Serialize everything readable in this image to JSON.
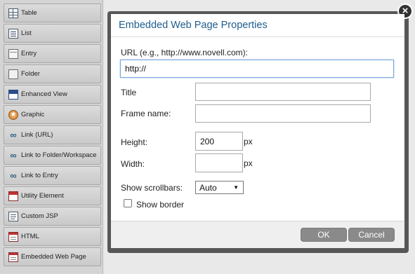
{
  "palette": {
    "items": [
      {
        "label": "Table",
        "icon": "table-icon"
      },
      {
        "label": "List",
        "icon": "list-icon"
      },
      {
        "label": "Entry",
        "icon": "entry-icon"
      },
      {
        "label": "Folder",
        "icon": "folder-icon"
      },
      {
        "label": "Enhanced View",
        "icon": "enhanced-view-icon"
      },
      {
        "label": "Graphic",
        "icon": "graphic-icon"
      },
      {
        "label": "Link (URL)",
        "icon": "link-icon"
      },
      {
        "label": "Link to Folder/Workspace",
        "icon": "link-icon"
      },
      {
        "label": "Link to Entry",
        "icon": "link-icon"
      },
      {
        "label": "Utility Element",
        "icon": "utility-element-icon"
      },
      {
        "label": "Custom JSP",
        "icon": "custom-jsp-icon"
      },
      {
        "label": "HTML",
        "icon": "html-icon"
      },
      {
        "label": "Embedded Web Page",
        "icon": "embedded-web-page-icon"
      }
    ]
  },
  "dialog": {
    "title": "Embedded Web Page Properties",
    "close_icon": "×",
    "url_label": "URL (e.g., http://www.novell.com):",
    "url_value": "http://",
    "title_label": "Title",
    "title_value": "",
    "frame_name_label": "Frame name:",
    "frame_name_value": "",
    "height_label": "Height:",
    "height_value": "200",
    "height_unit": "px",
    "width_label": "Width:",
    "width_value": "",
    "width_unit": "px",
    "scrollbars_label": "Show scrollbars:",
    "scrollbars_selected": "Auto",
    "show_border_label": "Show border",
    "show_border_checked": false,
    "ok_label": "OK",
    "cancel_label": "Cancel"
  },
  "colors": {
    "title_text": "#1f5d8c",
    "focus_border": "#7aa7d9",
    "button_bg": "#8a8a8a"
  }
}
